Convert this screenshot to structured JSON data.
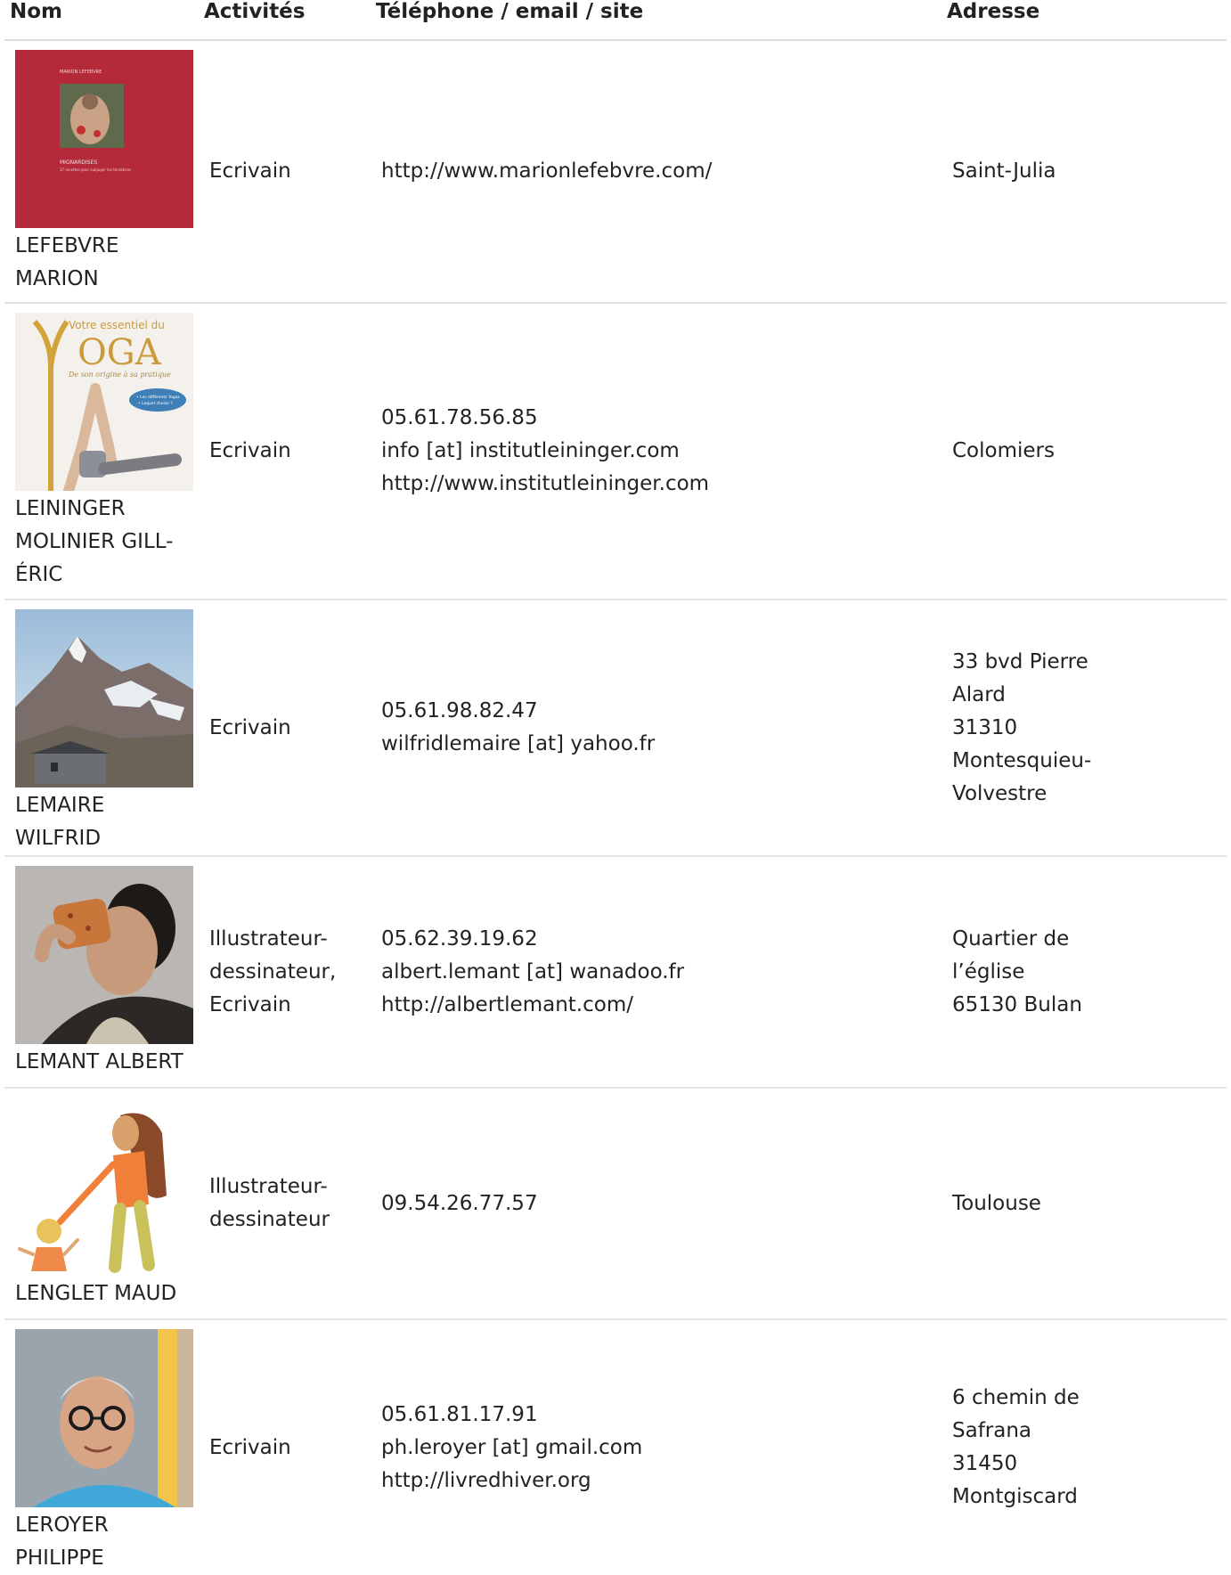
{
  "headers": {
    "nom": "Nom",
    "activites": "Activités",
    "contact": "Téléphone / email / site",
    "adresse": "Adresse"
  },
  "rows": [
    {
      "name_lines": [
        "LEFEBVRE",
        "MARION"
      ],
      "activity_lines": [
        "Ecrivain"
      ],
      "contact_lines": [
        "http://www.marionlefebvre.com/"
      ],
      "address_lines": [
        "Saint-Julia"
      ],
      "image": "book-cover-mignardises",
      "cover_text": {
        "author": "MARION LEFEBVRE",
        "title": "MIGNARDISES",
        "subtitle": "37 recettes pour subjuger les tentatives"
      }
    },
    {
      "name_lines": [
        "LEININGER",
        "MOLINIER GILL-",
        "ÉRIC"
      ],
      "activity_lines": [
        "Ecrivain"
      ],
      "contact_lines": [
        "05.61.78.56.85",
        "info [at] institutleininger.com",
        "http://www.institutleininger.com"
      ],
      "address_lines": [
        "Colomiers"
      ],
      "image": "book-cover-yoga",
      "cover_text": {
        "top": "Votre essentiel du",
        "title": "OGA",
        "subtitle": "De son origine à sa pratique",
        "badge1": "• Les différents Yogas",
        "badge2": "• Lequel choisir ?"
      }
    },
    {
      "name_lines": [
        "LEMAIRE WILFRID"
      ],
      "activity_lines": [
        "Ecrivain"
      ],
      "contact_lines": [
        "05.61.98.82.47",
        "wilfridlemaire [at] yahoo.fr"
      ],
      "address_lines": [
        "33 bvd Pierre",
        "Alard",
        "31310",
        "Montesquieu-",
        "Volvestre"
      ],
      "image": "mountain-photo"
    },
    {
      "name_lines": [
        "LEMANT ALBERT"
      ],
      "activity_lines": [
        "Illustrateur-",
        "dessinateur,",
        "Ecrivain"
      ],
      "contact_lines": [
        "05.62.39.19.62",
        "albert.lemant [at] wanadoo.fr",
        "http://albertlemant.com/"
      ],
      "address_lines": [
        "Quartier de",
        "l’église",
        "65130 Bulan"
      ],
      "image": "portrait-photo"
    },
    {
      "name_lines": [
        "LENGLET MAUD"
      ],
      "activity_lines": [
        "Illustrateur-",
        "dessinateur"
      ],
      "contact_lines": [
        "09.54.26.77.57"
      ],
      "address_lines": [
        "Toulouse"
      ],
      "image": "illustration-mother-child"
    },
    {
      "name_lines": [
        "LEROYER PHILIPPE"
      ],
      "activity_lines": [
        "Ecrivain"
      ],
      "contact_lines": [
        "05.61.81.17.91",
        "ph.leroyer [at] gmail.com",
        "http://livredhiver.org"
      ],
      "address_lines": [
        "6 chemin de",
        "Safrana",
        "31450",
        "Montgiscard"
      ],
      "image": "portrait-glasses-photo"
    }
  ]
}
